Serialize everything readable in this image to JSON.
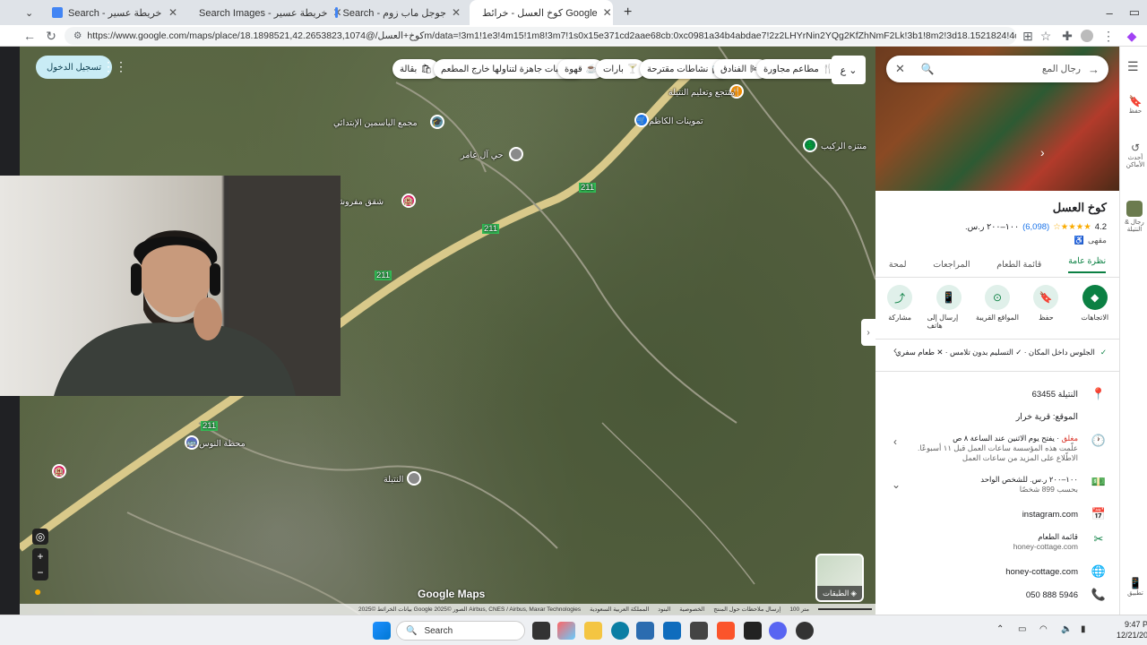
{
  "browser": {
    "tabs": [
      {
        "label": "Search - خريطة عسير"
      },
      {
        "label": "Search Images - خريطة عسير"
      },
      {
        "label": "Search - جوجل ماب زوم"
      },
      {
        "label": "كوخ العسل - خرائط Google"
      }
    ],
    "url": "https://www.google.com/maps/place/كوخ+العسل/@18.1898521,42.2653823,1074m/data=!3m1!1e3!4m15!1m8!3m7!1s0x15e371cd2aae68cb:0xc0981a34b4abdae7!2z2LHYrNin2YQg2KfZhNmF2Lk!3b1!8m2!3d18.1521824!4d42.1572702!16s..."
  },
  "map": {
    "sign_in": "تسجيل الدخول",
    "chips": [
      {
        "label": "مطاعم مجاورة",
        "icon": "restaurant-icon"
      },
      {
        "label": "الفنادق",
        "icon": "hotel-icon"
      },
      {
        "label": "نشاطات مقترحة",
        "icon": "camera-icon"
      },
      {
        "label": "بارات",
        "icon": "bar-icon"
      },
      {
        "label": "قهوة",
        "icon": "coffee-icon"
      },
      {
        "label": "وجبات جاهزة لتناولها خارج المطعم",
        "icon": "takeout-icon"
      },
      {
        "label": "بقالة",
        "icon": "grocery-icon"
      }
    ],
    "labels": {
      "school": "مجمع الياسمين الإبتدائي",
      "area1": "حي آل عامر",
      "apartments": "شقق مفروشة",
      "store": "تموينات الكاظم",
      "road": "منتزه الركيب",
      "cafe": "منتجع وتعليم النتيلة",
      "bus": "محطة النوس",
      "nutayla": "النتيلة",
      "route_211": "211",
      "route_211b": "211",
      "route_211c": "211",
      "route_211d": "211"
    },
    "layers_label": "الطبقات",
    "google_maps": "Google Maps",
    "footer": "بيانات الخرائط ©2025 Google الصور ©2025 Airbus, CNES / Airbus, Maxar Technologies",
    "footer_links": [
      "المملكة العربية السعودية",
      "البنود",
      "الخصوصية",
      "إرسال ملاحظات حول المنتج"
    ],
    "scale": "100 متر"
  },
  "panel": {
    "search_text": "رجال المع",
    "name": "كوخ العسل",
    "rating": "4.2",
    "stars": "★★★★☆",
    "reviews": "(6,098)",
    "price": "١٠٠–٢٠٠ ر.س.",
    "category": "مقهى",
    "tabs": [
      "نظرة عامة",
      "قائمة الطعام",
      "المراجعات",
      "لمحة"
    ],
    "actions": [
      {
        "label": "الاتجاهات",
        "icon": "directions-icon"
      },
      {
        "label": "حفظ",
        "icon": "bookmark-icon"
      },
      {
        "label": "المواقع القريبة",
        "icon": "nearby-icon"
      },
      {
        "label": "إرسال إلى هاتف",
        "icon": "phone-send-icon"
      },
      {
        "label": "مشاركة",
        "icon": "share-icon"
      }
    ],
    "amenities": "الجلوس داخل المكان · ✓ التسليم بدون تلامس · ✕ طعام سفري",
    "postal": "63455 النتيلة",
    "located_in": "الموقع: قرية خرار",
    "hours_status": "مغلق",
    "hours": "· يفتح يوم الاثنين عند الساعة ٨ ص",
    "hours_note": "علّمت هذه المؤسسة ساعات العمل قبل ١١ أسبوعًا.",
    "hours_note2": "الاطّلاع على المزيد من ساعات العمل",
    "price_row": "١٠٠–٢٠٠ ر.س. للشخص الواحد",
    "price_note": "بحسب 899 شخصًا",
    "instagram": "instagram.com",
    "menu_label": "قائمة الطعام",
    "menu_url": "honey-cottage.com",
    "website": "honey-cottage.com",
    "phone": "050 888 5946"
  },
  "right_strip": {
    "saved": "حفظ",
    "recent": "أحدث الأماكن",
    "place": "رجال & النتيلة",
    "get_app": "تطبيق"
  },
  "taskbar": {
    "search": "Search",
    "time": "9:47 P",
    "date": "12/21/20"
  },
  "colors": {
    "accent": "#0b8043",
    "road": "#d9c98a"
  }
}
